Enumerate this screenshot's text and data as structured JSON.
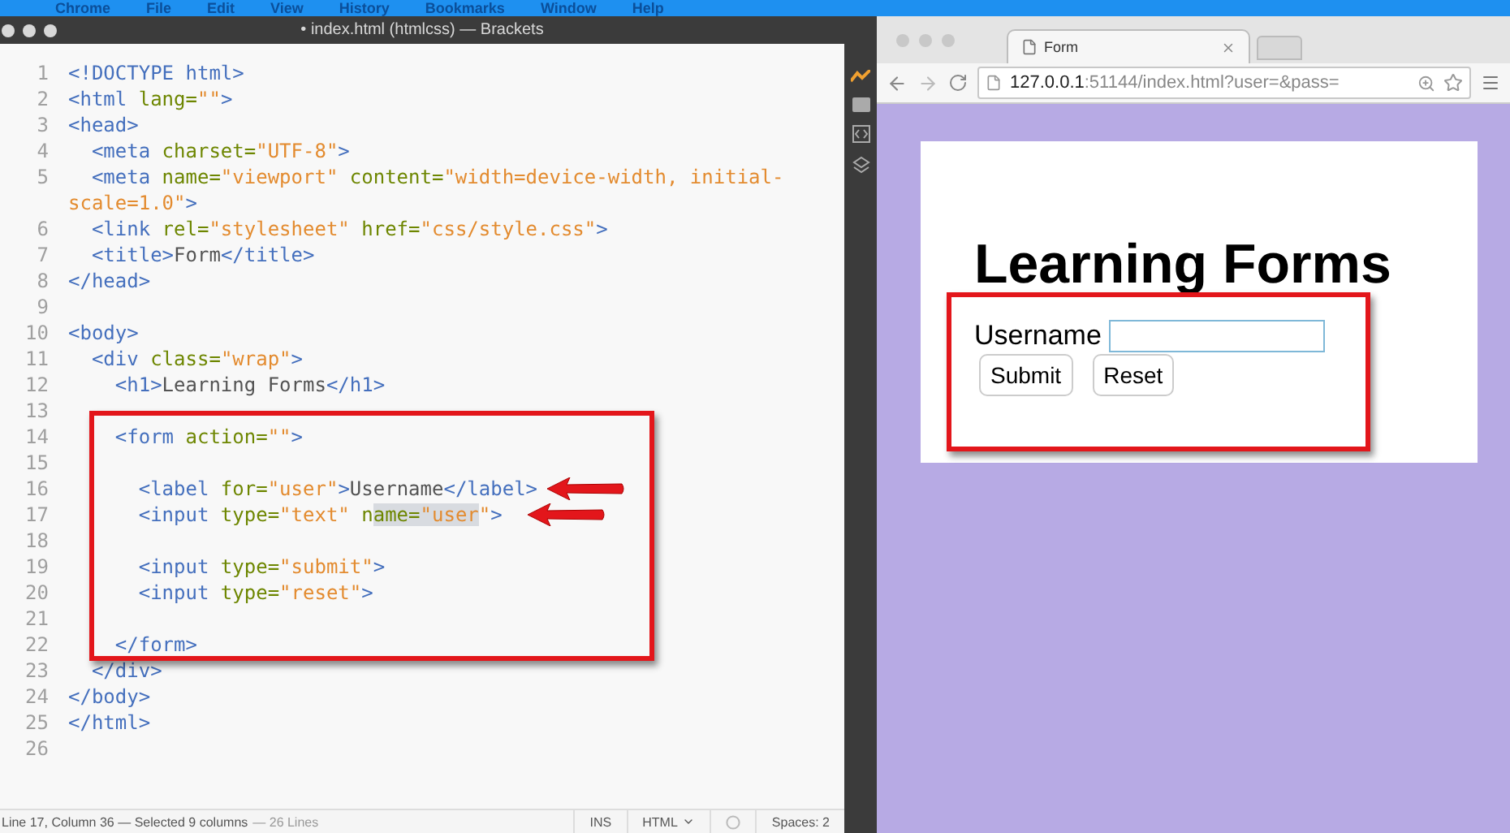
{
  "menu_bar": {
    "items": [
      "Chrome",
      "File",
      "Edit",
      "View",
      "History",
      "Bookmarks",
      "Window",
      "Help"
    ]
  },
  "editor": {
    "title": "• index.html (htmlcss) — Brackets",
    "lines": [
      {
        "number": "1",
        "tokens": [
          {
            "kind": "tag",
            "text": "<!DOCTYPE html>"
          }
        ]
      },
      {
        "number": "2",
        "tokens": [
          {
            "kind": "tag",
            "text": "<html "
          },
          {
            "kind": "attr",
            "text": "lang="
          },
          {
            "kind": "string",
            "text": "\"\""
          },
          {
            "kind": "tag",
            "text": ">"
          }
        ]
      },
      {
        "number": "3",
        "tokens": [
          {
            "kind": "tag",
            "text": "<head>"
          }
        ]
      },
      {
        "number": "4",
        "tokens": [
          {
            "kind": "tag",
            "text": "  <meta "
          },
          {
            "kind": "attr",
            "text": "charset="
          },
          {
            "kind": "string",
            "text": "\"UTF-8\""
          },
          {
            "kind": "tag",
            "text": ">"
          }
        ]
      },
      {
        "number": "5",
        "tokens": [
          {
            "kind": "tag",
            "text": "  <meta "
          },
          {
            "kind": "attr",
            "text": "name="
          },
          {
            "kind": "string",
            "text": "\"viewport\""
          },
          {
            "kind": "attr",
            "text": " content="
          },
          {
            "kind": "string",
            "text": "\"width=device-width, initial-"
          }
        ]
      },
      {
        "tokens": [
          {
            "kind": "string",
            "text": "scale=1.0\""
          },
          {
            "kind": "tag",
            "text": ">"
          }
        ]
      },
      {
        "number": "6",
        "tokens": [
          {
            "kind": "tag",
            "text": "  <link "
          },
          {
            "kind": "attr",
            "text": "rel="
          },
          {
            "kind": "string",
            "text": "\"stylesheet\""
          },
          {
            "kind": "attr",
            "text": " href="
          },
          {
            "kind": "string",
            "text": "\"css/style.css\""
          },
          {
            "kind": "tag",
            "text": ">"
          }
        ]
      },
      {
        "number": "7",
        "tokens": [
          {
            "kind": "tag",
            "text": "  <title>"
          },
          {
            "kind": "text",
            "text": "Form"
          },
          {
            "kind": "tag",
            "text": "</title>"
          }
        ]
      },
      {
        "number": "8",
        "tokens": [
          {
            "kind": "tag",
            "text": "</head>"
          }
        ]
      },
      {
        "number": "9"
      },
      {
        "number": "10",
        "tokens": [
          {
            "kind": "tag",
            "text": "<body>"
          }
        ]
      },
      {
        "number": "11",
        "tokens": [
          {
            "kind": "tag",
            "text": "  <div "
          },
          {
            "kind": "attr",
            "text": "class="
          },
          {
            "kind": "string",
            "text": "\"wrap\""
          },
          {
            "kind": "tag",
            "text": ">"
          }
        ]
      },
      {
        "number": "12",
        "tokens": [
          {
            "kind": "tag",
            "text": "    <h1>"
          },
          {
            "kind": "text",
            "text": "Learning Forms"
          },
          {
            "kind": "tag",
            "text": "</h1>"
          }
        ]
      },
      {
        "number": "13"
      },
      {
        "number": "14",
        "tokens": [
          {
            "kind": "tag",
            "text": "    <form "
          },
          {
            "kind": "attr",
            "text": "action="
          },
          {
            "kind": "string",
            "text": "\"\""
          },
          {
            "kind": "tag",
            "text": ">"
          }
        ]
      },
      {
        "number": "15"
      },
      {
        "number": "16",
        "tokens": [
          {
            "kind": "tag",
            "text": "      <label "
          },
          {
            "kind": "attr",
            "text": "for="
          },
          {
            "kind": "string",
            "text": "\"user\""
          },
          {
            "kind": "tag",
            "text": ">"
          },
          {
            "kind": "text",
            "text": "Username"
          },
          {
            "kind": "tag",
            "text": "</label>"
          }
        ]
      },
      {
        "number": "17",
        "tokens": [
          {
            "kind": "tag",
            "text": "      <input "
          },
          {
            "kind": "attr",
            "text": "type="
          },
          {
            "kind": "string",
            "text": "\"text\""
          },
          {
            "kind": "attr",
            "text": " n"
          },
          {
            "kind": "attr",
            "text": "ame=",
            "selected": true
          },
          {
            "kind": "string",
            "text": "\"user",
            "selected": true
          },
          {
            "kind": "string",
            "text": "\""
          },
          {
            "kind": "tag",
            "text": ">"
          }
        ]
      },
      {
        "number": "18"
      },
      {
        "number": "19",
        "tokens": [
          {
            "kind": "tag",
            "text": "      <input "
          },
          {
            "kind": "attr",
            "text": "type="
          },
          {
            "kind": "string",
            "text": "\"submit\""
          },
          {
            "kind": "tag",
            "text": ">"
          }
        ]
      },
      {
        "number": "20",
        "tokens": [
          {
            "kind": "tag",
            "text": "      <input "
          },
          {
            "kind": "attr",
            "text": "type="
          },
          {
            "kind": "string",
            "text": "\"reset\""
          },
          {
            "kind": "tag",
            "text": ">"
          }
        ]
      },
      {
        "number": "21"
      },
      {
        "number": "22",
        "tokens": [
          {
            "kind": "tag",
            "text": "    </form>"
          }
        ]
      },
      {
        "number": "23",
        "tokens": [
          {
            "kind": "tag",
            "text": "  </div>"
          }
        ]
      },
      {
        "number": "24",
        "tokens": [
          {
            "kind": "tag",
            "text": "</body>"
          }
        ]
      },
      {
        "number": "25",
        "tokens": [
          {
            "kind": "tag",
            "text": "</html>"
          }
        ]
      },
      {
        "number": "26"
      }
    ],
    "status_bar": {
      "position": "Line 17, Column 36 — Selected 9 columns",
      "line_count": "— 26 Lines",
      "mode": "INS",
      "language": "HTML",
      "indent": "Spaces: 2"
    }
  },
  "browser": {
    "tabs": [
      {
        "title": "Form",
        "selected": true
      }
    ],
    "url": "**127.0.0.1**:51144/index.html?user=&pass=",
    "page": {
      "heading": "Learning Forms",
      "label": "Username",
      "buttons": [
        "Submit",
        "Reset"
      ]
    }
  }
}
